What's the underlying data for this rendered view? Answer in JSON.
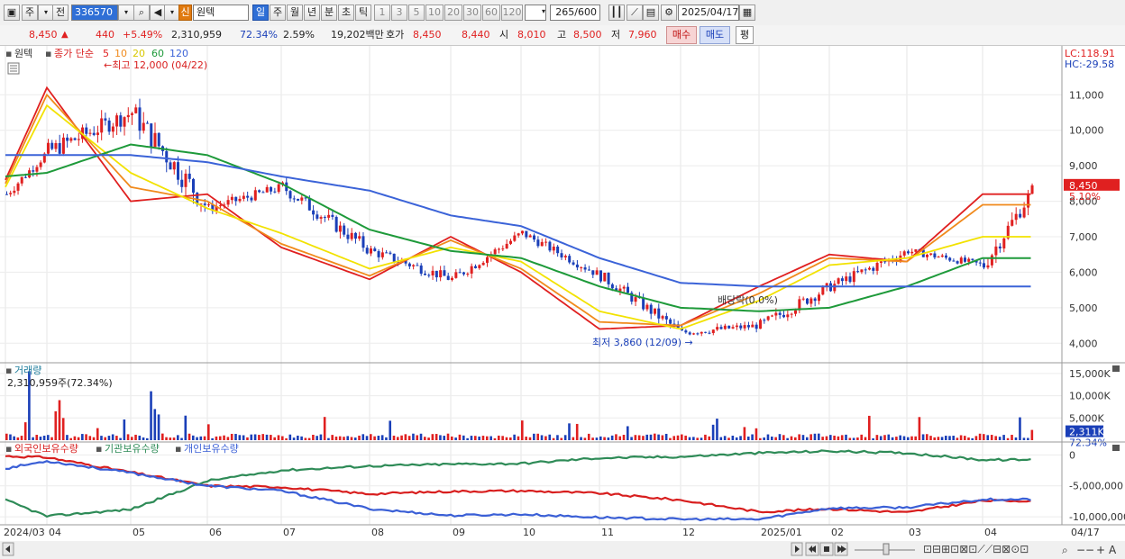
{
  "toolbar": {
    "kind_label": "주",
    "prev_label": "전",
    "code": "336570",
    "badge": "신",
    "stock_name": "원텍",
    "periods": [
      "일",
      "주",
      "월",
      "년",
      "분",
      "초",
      "틱"
    ],
    "active_period": "일",
    "minute_values": [
      "1",
      "3",
      "5",
      "10",
      "20",
      "30",
      "60",
      "120"
    ],
    "count_value": "265",
    "count_max": "/600",
    "date": "2025/04/17"
  },
  "quote": {
    "price": "8,450",
    "change": "440",
    "change_pct": "+5.49%",
    "volume": "2,310,959",
    "volume_ratio": "72.34%",
    "turnover": "2.59%",
    "amount": "19,202백만",
    "ask_label": "호가",
    "ask1": "8,450",
    "ask2": "8,440",
    "open_label": "시",
    "open": "8,010",
    "high_label": "고",
    "high": "8,500",
    "low_label": "저",
    "low": "7,960",
    "buy_label": "매수",
    "sell_label": "매도",
    "eval_label": "평"
  },
  "price_panel": {
    "legend_name": "원텍",
    "ma_label": "종가 단순",
    "ma_periods": [
      "5",
      "10",
      "20",
      "60",
      "120"
    ],
    "high_annotation": "최고 12,000 (04/22)",
    "low_annotation": "최저 3,860 (12/09)",
    "event_annotation": "배당락(0.0%)",
    "lc": "LC:118.91",
    "hc": "HC:-29.58",
    "price_tag": "8,450",
    "pct_tag": "5.10%",
    "y_labels": [
      "11,000",
      "10,000",
      "9,000",
      "8,000",
      "7,000",
      "6,000",
      "5,000",
      "4,000"
    ]
  },
  "volume_panel": {
    "title": "거래량",
    "info": "2,310,959주(72.34%)",
    "y_labels": [
      "15,000K",
      "10,000K",
      "5,000K"
    ],
    "tag": "2,311K",
    "tag_pct": "72.34%"
  },
  "investor_panel": {
    "legend": [
      "외국인보유수량",
      "기관보유수량",
      "개인보유수량"
    ],
    "y_labels": [
      "0",
      "-5,000,000",
      "-10,000,000"
    ]
  },
  "x_axis": [
    "2024/03",
    "04",
    "05",
    "06",
    "07",
    "08",
    "09",
    "10",
    "11",
    "12",
    "2025/01",
    "02",
    "03",
    "04",
    "04/17"
  ],
  "colors": {
    "up": "#e02020",
    "down": "#1a3fb8",
    "ma5": "#e02020",
    "ma10": "#f08a1c",
    "ma20": "#f2e200",
    "ma60": "#1e9a3a",
    "ma120": "#3b63d8",
    "foreign": "#d81e1e",
    "institution": "#2e8b57",
    "retail": "#3a5fd6"
  },
  "chart_data": {
    "type": "candlestick",
    "unit": "KRW",
    "ylim": [
      3600,
      12000
    ],
    "monthly": [
      {
        "month": "2024/03",
        "open": 8200,
        "high": 9600,
        "low": 8000,
        "close": 9400
      },
      {
        "month": "2024/04",
        "open": 9400,
        "high": 12000,
        "low": 9200,
        "close": 10500
      },
      {
        "month": "2024/05",
        "open": 10500,
        "high": 11500,
        "low": 7600,
        "close": 7800
      },
      {
        "month": "2024/06",
        "open": 7800,
        "high": 8800,
        "low": 7300,
        "close": 8400
      },
      {
        "month": "2024/07",
        "open": 8400,
        "high": 8700,
        "low": 6500,
        "close": 6600
      },
      {
        "month": "2024/08",
        "open": 6600,
        "high": 7200,
        "low": 5600,
        "close": 5800
      },
      {
        "month": "2024/09",
        "open": 5800,
        "high": 7300,
        "low": 5700,
        "close": 7100
      },
      {
        "month": "2024/10",
        "open": 7100,
        "high": 7200,
        "low": 5800,
        "close": 5900
      },
      {
        "month": "2024/11",
        "open": 5900,
        "high": 6000,
        "low": 4200,
        "close": 4300
      },
      {
        "month": "2024/12",
        "open": 4300,
        "high": 5000,
        "low": 3860,
        "close": 4500
      },
      {
        "month": "2025/01",
        "open": 4500,
        "high": 6100,
        "low": 4300,
        "close": 5600
      },
      {
        "month": "2025/02",
        "open": 5600,
        "high": 6900,
        "low": 5200,
        "close": 6600
      },
      {
        "month": "2025/03",
        "open": 6600,
        "high": 7000,
        "low": 5900,
        "close": 6200
      },
      {
        "month": "2025/04",
        "open": 6200,
        "high": 8500,
        "low": 6000,
        "close": 8450
      }
    ],
    "series": [
      {
        "name": "5",
        "values": [
          8600,
          11200,
          8000,
          8200,
          6700,
          5800,
          7000,
          6000,
          4400,
          4500,
          5600,
          6500,
          6300,
          8200
        ]
      },
      {
        "name": "10",
        "values": [
          8500,
          11000,
          8400,
          8000,
          6800,
          5900,
          6900,
          6100,
          4600,
          4500,
          5400,
          6400,
          6300,
          7900
        ]
      },
      {
        "name": "20",
        "values": [
          8400,
          10700,
          8800,
          7800,
          7100,
          6100,
          6700,
          6300,
          4900,
          4400,
          5200,
          6200,
          6400,
          7000
        ]
      },
      {
        "name": "60",
        "values": [
          8700,
          8800,
          9600,
          9300,
          8500,
          7200,
          6600,
          6400,
          5600,
          5000,
          4900,
          5000,
          5600,
          6400
        ]
      },
      {
        "name": "120",
        "values": [
          9300,
          9300,
          9300,
          9100,
          8700,
          8300,
          7600,
          7300,
          6400,
          5700,
          5600,
          5600,
          5600,
          5600
        ]
      }
    ],
    "volume_series": {
      "name": "거래량",
      "unit": "K",
      "ylim": [
        0,
        17000
      ],
      "last": 2311,
      "peaks": [
        {
          "month": "2024/03",
          "value": 15500
        },
        {
          "month": "2024/05",
          "value": 11000
        }
      ]
    },
    "investor_series": [
      {
        "name": "외국인보유수량",
        "ylim": [
          -11000000,
          1500000
        ],
        "values": [
          -200000,
          -400000,
          -2800000,
          -5000000,
          -5200000,
          -6300000,
          -5900000,
          -5800000,
          -6200000,
          -7300000,
          -9200000,
          -8700000,
          -9300000,
          -7400000
        ]
      },
      {
        "name": "기관보유수량",
        "values": [
          -7300000,
          -9900000,
          -8800000,
          -4200000,
          -2500000,
          -1800000,
          -1500000,
          -1400000,
          -500000,
          -300000,
          300000,
          600000,
          300000,
          -800000
        ]
      },
      {
        "name": "개인보유수량",
        "values": [
          -2200000,
          -1000000,
          -2900000,
          -5000000,
          -5800000,
          -8700000,
          -9800000,
          -9600000,
          -10100000,
          -10400000,
          -10400000,
          -8600000,
          -8500000,
          -7200000
        ]
      }
    ]
  }
}
